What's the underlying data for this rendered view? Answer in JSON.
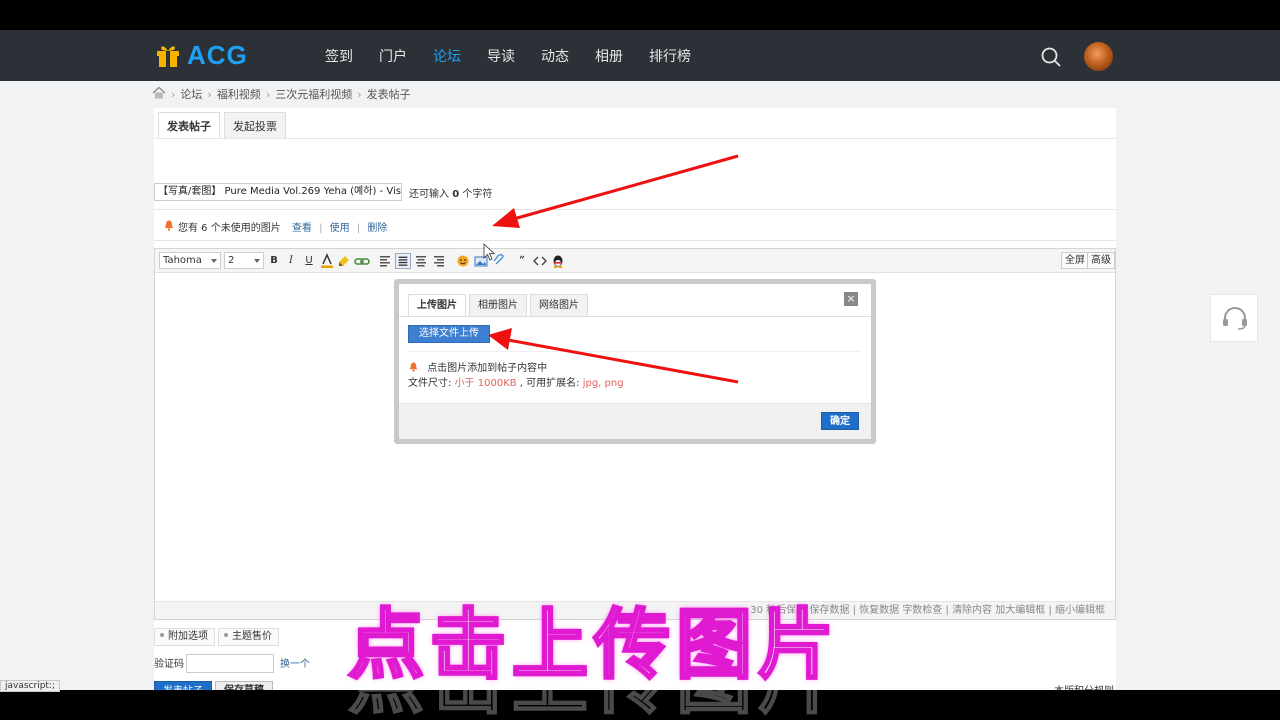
{
  "header": {
    "logo_text": "ACG",
    "nav": [
      "签到",
      "门户",
      "论坛",
      "导读",
      "动态",
      "相册",
      "排行榜"
    ],
    "active_nav": "论坛"
  },
  "breadcrumb": [
    "论坛",
    "福利视频",
    "三次元福利视频",
    "发表帖子"
  ],
  "post_tabs": [
    "发表帖子",
    "发起投票"
  ],
  "title_input": {
    "value": "【写真/套图】 Pure Media Vol.269 Yeha (예하) - Visit '",
    "remaining_prefix": "还可输入",
    "remaining_count": "0",
    "remaining_suffix": "个字符"
  },
  "unused_images": {
    "text": "您有 6 个未使用的图片",
    "view": "查看",
    "use": "使用",
    "delete": "删除"
  },
  "editor": {
    "font_family": "Tahoma",
    "font_size": "2",
    "fullscreen": "全屏",
    "advanced": "高级",
    "status": {
      "autosave": "30 秒后保存",
      "save": "保存数据",
      "restore": "恢复数据",
      "wordcheck": "字数检查",
      "clear": "清除内容",
      "enlarge": "加大编辑框",
      "shrink": "缩小编辑框"
    }
  },
  "image_dialog": {
    "tabs": [
      "上传图片",
      "相册图片",
      "网络图片"
    ],
    "close": "×",
    "upload_button": "选择文件上传",
    "hint": "点击图片添加到帖子内容中",
    "size_prefix": "文件尺寸: ",
    "size_limit": "小于 1000KB",
    "ext_prefix": " , 可用扩展名: ",
    "extensions": "jpg, png",
    "confirm": "确定"
  },
  "options": [
    "附加选项",
    "主题售价"
  ],
  "captcha": {
    "label": "验证码",
    "refresh": "换一个"
  },
  "actions": {
    "submit": "发表帖子",
    "save_draft": "保存草稿",
    "rules": "本版积分规则"
  },
  "status_url": "javascript:;",
  "caption": "点击上传图片",
  "colors": {
    "header_bg": "#2b3137",
    "accent": "#1da1f2",
    "primary_button": "#1f6fc8",
    "caption_stroke": "#e01ad0",
    "arrow": "#ee1111"
  }
}
